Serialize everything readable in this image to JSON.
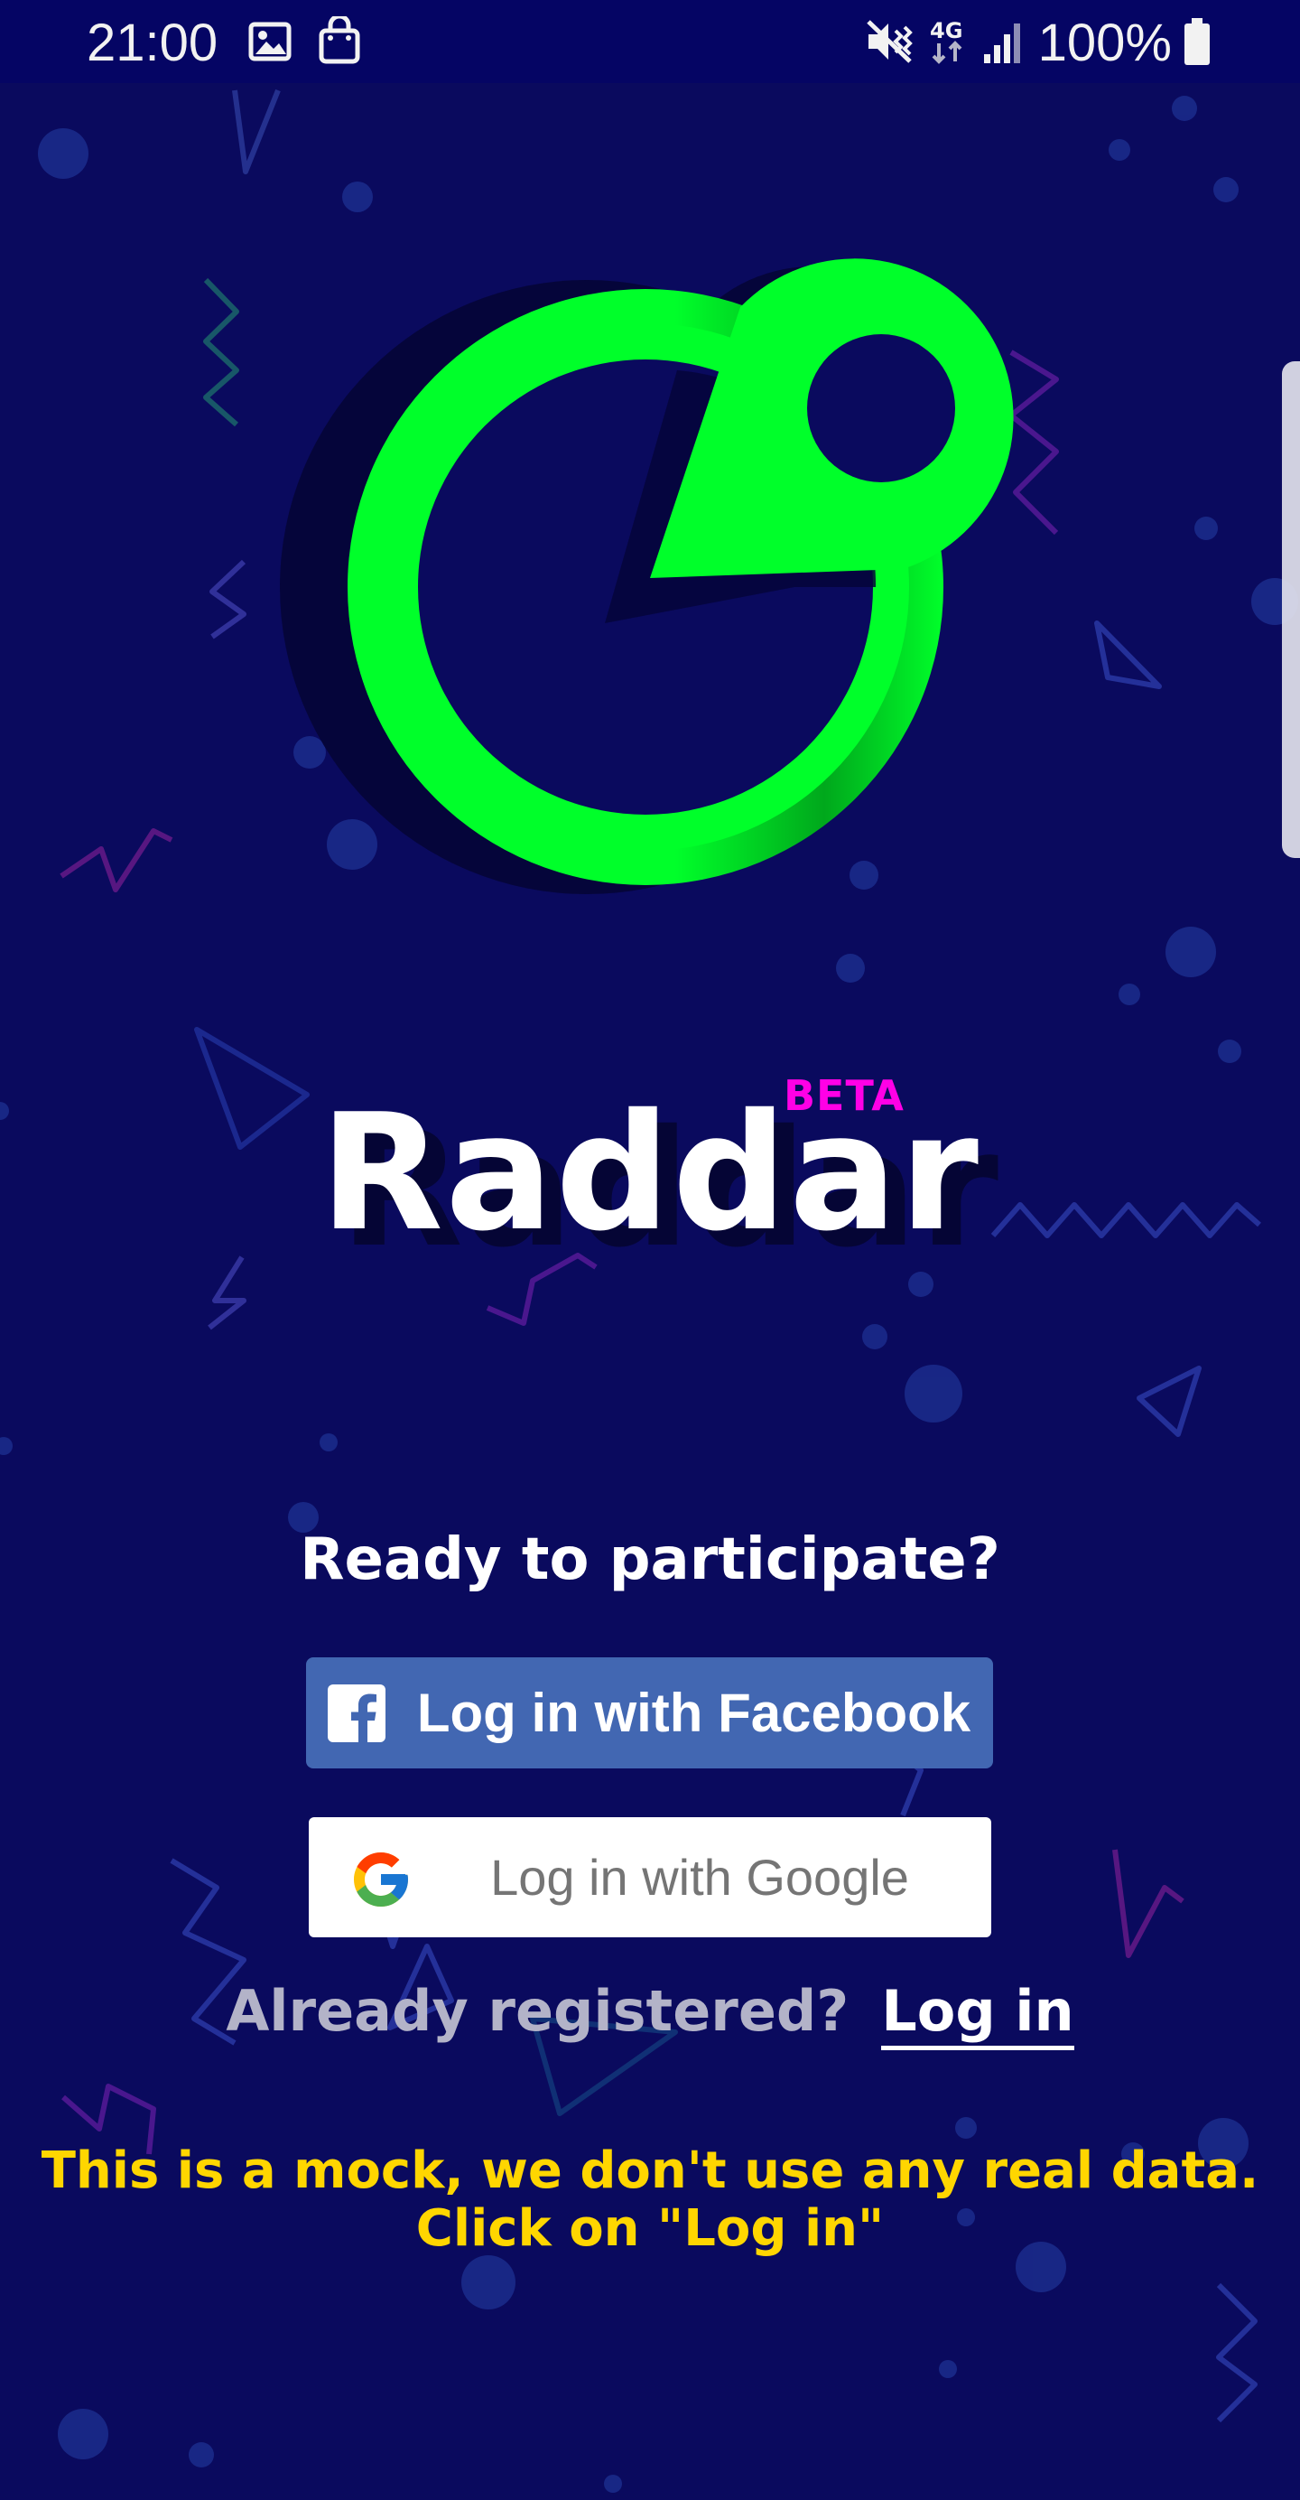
{
  "status_bar": {
    "time": "21:00",
    "battery_text": "100%",
    "icons": [
      "image-icon",
      "shopping-bag-icon",
      "mute-vibrate-icon",
      "4g-data-icon",
      "signal-icon",
      "battery-icon"
    ]
  },
  "brand": {
    "name": "Raddar",
    "badge": "BETA",
    "logo_icon": "radar-pin-logo",
    "colors": {
      "accent": "#00ff2a",
      "badge": "#ff00e6",
      "background": "#0a0a5e"
    }
  },
  "auth": {
    "prompt": "Ready to participate?",
    "facebook_button": {
      "label": "Log in with Facebook",
      "icon": "facebook-icon",
      "color": "#4267b2"
    },
    "google_button": {
      "label": "Log in with Google",
      "icon": "google-icon"
    },
    "already_registered": "Already registered?",
    "login_link": "Log in"
  },
  "notice": {
    "line1": "This is a mock, we don't use any real data.",
    "line2": "Click on \"Log in\"",
    "color": "#ffd600"
  }
}
